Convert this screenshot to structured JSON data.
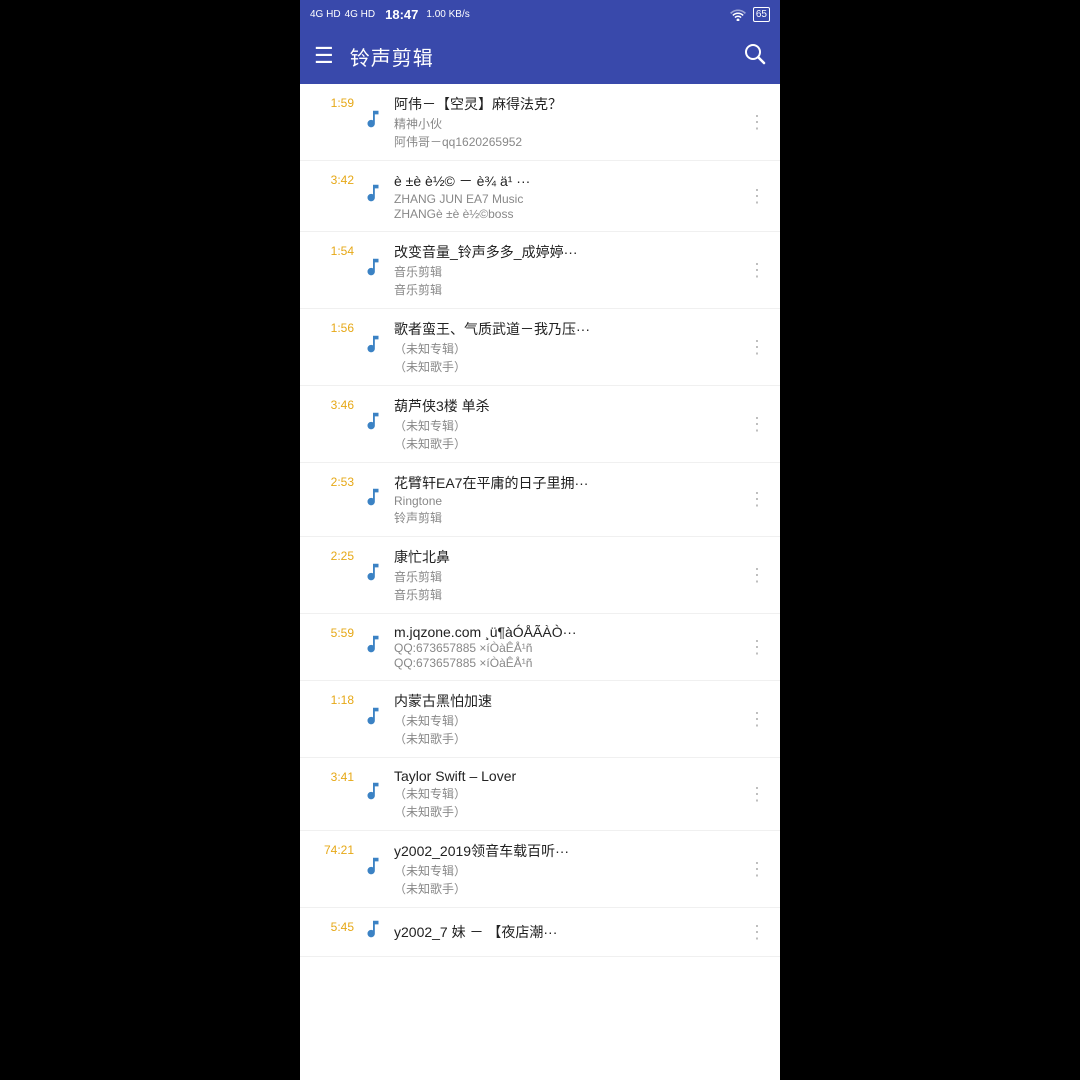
{
  "statusBar": {
    "network1": "4G HD",
    "network2": "4G HD",
    "time": "18:47",
    "speed": "1.00 KB/s",
    "battery": "65"
  },
  "header": {
    "title": "铃声剪辑",
    "menu_label": "☰",
    "search_label": "🔍"
  },
  "tracks": [
    {
      "time": "1:59",
      "title": "阿伟－【空灵】麻得法克？",
      "sub1": "精神小伙",
      "sub2": "阿伟哥－qq1620265952"
    },
    {
      "time": "3:42",
      "title": "è ±è    è½© － è¾  ä¹ ···",
      "sub1": "ZHANG JUN EA7 Music",
      "sub2": "ZHANGè ±è    è½©boss"
    },
    {
      "time": "1:54",
      "title": "改变音量_铃声多多_成婷婷···",
      "sub1": "音乐剪辑",
      "sub2": "音乐剪辑"
    },
    {
      "time": "1:56",
      "title": "歌者蛮王、气质武道－我乃压···",
      "sub1": "（未知专辑）",
      "sub2": "（未知歌手）"
    },
    {
      "time": "3:46",
      "title": "葫芦侠3楼 单杀",
      "sub1": "（未知专辑）",
      "sub2": "（未知歌手）"
    },
    {
      "time": "2:53",
      "title": "花臂轩EA7在平庸的日子里拥···",
      "sub1": "Ringtone",
      "sub2": "铃声剪辑"
    },
    {
      "time": "2:25",
      "title": "康忙北鼻",
      "sub1": "音乐剪辑",
      "sub2": "音乐剪辑"
    },
    {
      "time": "5:59",
      "title": "m.jqzone.com ¸ü¶àÓÅÃÀÒ···",
      "sub1": "QQ:673657885 ×íÒàÊÅ¹ñ",
      "sub2": "QQ:673657885 ×íÒàÊÅ¹ñ"
    },
    {
      "time": "1:18",
      "title": "内蒙古黑怕加速",
      "sub1": "（未知专辑）",
      "sub2": "（未知歌手）"
    },
    {
      "time": "3:41",
      "title": "Taylor Swift – Lover",
      "sub1": "（未知专辑）",
      "sub2": "（未知歌手）"
    },
    {
      "time": "74:21",
      "title": "y2002_2019领音车载百听···",
      "sub1": "（未知专辑）",
      "sub2": "（未知歌手）"
    },
    {
      "time": "5:45",
      "title": "y2002_7  妹 － 【夜店潮···",
      "sub1": "",
      "sub2": ""
    }
  ]
}
